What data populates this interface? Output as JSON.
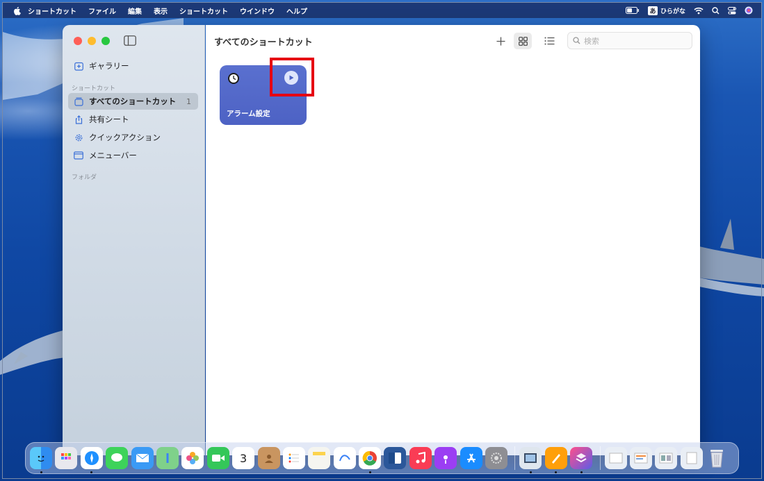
{
  "menubar": {
    "app_name": "ショートカット",
    "items": [
      "ファイル",
      "編集",
      "表示",
      "ショートカット",
      "ウインドウ",
      "ヘルプ"
    ],
    "ime_badge": "あ",
    "ime_label": "ひらがな"
  },
  "window": {
    "title": "すべてのショートカット",
    "search_placeholder": "検索",
    "sidebar": {
      "gallery_label": "ギャラリー",
      "section_shortcuts": "ショートカット",
      "items": [
        {
          "label": "すべてのショートカット",
          "count": "1",
          "icon": "square-stack-icon"
        },
        {
          "label": "共有シート",
          "icon": "share-icon"
        },
        {
          "label": "クイックアクション",
          "icon": "gear-icon"
        },
        {
          "label": "メニューバー",
          "icon": "menubar-icon"
        }
      ],
      "section_folders": "フォルダ"
    },
    "shortcut_card": {
      "title": "アラーム設定",
      "icon": "clock-icon",
      "color": "#5a70cf"
    }
  },
  "dock": {
    "calendar_day": "3"
  },
  "colors": {
    "highlight": "#e60012",
    "traffic_close": "#fe5f57",
    "traffic_min": "#febc2e",
    "traffic_max": "#28c840"
  }
}
